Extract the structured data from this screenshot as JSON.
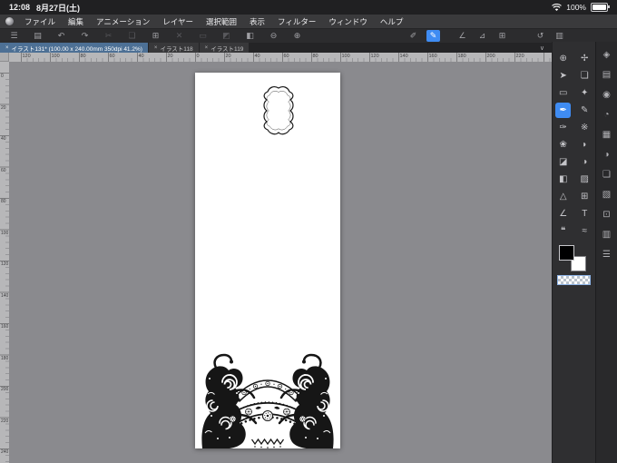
{
  "status_bar": {
    "time": "12:08",
    "date": "8月27日(土)",
    "battery_percent": "100%"
  },
  "menu_bar": {
    "items": [
      {
        "name": "menu-file",
        "label": "ファイル"
      },
      {
        "name": "menu-edit",
        "label": "編集"
      },
      {
        "name": "menu-animation",
        "label": "アニメーション"
      },
      {
        "name": "menu-layer",
        "label": "レイヤー"
      },
      {
        "name": "menu-selection",
        "label": "選択範囲"
      },
      {
        "name": "menu-view",
        "label": "表示"
      },
      {
        "name": "menu-filter",
        "label": "フィルター"
      },
      {
        "name": "menu-window",
        "label": "ウィンドウ"
      },
      {
        "name": "menu-help",
        "label": "ヘルプ"
      }
    ]
  },
  "command_bar": {
    "left_icons": [
      {
        "name": "app-menu-icon",
        "glyph": "☰"
      },
      {
        "name": "save-icon",
        "glyph": "▤"
      },
      {
        "name": "undo-icon",
        "glyph": "↶"
      },
      {
        "name": "redo-icon",
        "glyph": "↷"
      },
      {
        "name": "cut-icon",
        "glyph": "✂",
        "disabled": true
      },
      {
        "name": "copy-icon",
        "glyph": "❏",
        "disabled": true
      },
      {
        "name": "paste-icon",
        "glyph": "⊞"
      },
      {
        "name": "delete-icon",
        "glyph": "✕",
        "disabled": true
      },
      {
        "name": "deselect-icon",
        "glyph": "▭",
        "disabled": true
      },
      {
        "name": "invert-selection-icon",
        "glyph": "◩",
        "disabled": true
      },
      {
        "name": "fill-icon",
        "glyph": "◧"
      },
      {
        "name": "zoom-out-icon",
        "glyph": "⊖"
      },
      {
        "name": "zoom-in-icon",
        "glyph": "⊕"
      }
    ],
    "mode_icons": [
      {
        "name": "line-edit-icon",
        "glyph": "✐"
      },
      {
        "name": "draw-line-icon",
        "glyph": "✎",
        "active": true
      }
    ],
    "snap_icons": [
      {
        "name": "snap-ruler-icon",
        "glyph": "∠"
      },
      {
        "name": "snap-special-ruler-icon",
        "glyph": "⊿"
      },
      {
        "name": "snap-grid-icon",
        "glyph": "⊞"
      }
    ],
    "view_icons": [
      {
        "name": "rotate-reset-icon",
        "glyph": "↺"
      },
      {
        "name": "panel-layout-icon",
        "glyph": "▥"
      }
    ]
  },
  "tab_bar": {
    "tabs": [
      {
        "name": "tab-illust-131",
        "label": "イラスト131* (100.00 x 240.00mm 350dpi 41.2%)",
        "close": "×",
        "active": true
      },
      {
        "name": "tab-illust-118",
        "label": "イラスト118",
        "close": "×",
        "active": false
      },
      {
        "name": "tab-illust-119",
        "label": "イラスト119",
        "close": "×",
        "active": false
      }
    ],
    "overflow_icon": "∨"
  },
  "rulers": {
    "horizontal": [
      120,
      100,
      80,
      60,
      40,
      20,
      0,
      20,
      40,
      60,
      80,
      100,
      120,
      140,
      160,
      180,
      200,
      220
    ],
    "vertical": [
      0,
      20,
      40,
      60,
      80,
      100,
      120,
      140,
      160,
      180,
      200,
      220,
      240
    ]
  },
  "tool_panel": {
    "tools": [
      {
        "name": "zoom-tool-icon",
        "glyph": "⊕"
      },
      {
        "name": "pan-tool-icon",
        "glyph": "✢"
      },
      {
        "name": "operation-tool-icon",
        "glyph": "➤"
      },
      {
        "name": "layer-move-tool-icon",
        "glyph": "❏"
      },
      {
        "name": "selection-tool-icon",
        "glyph": "▭"
      },
      {
        "name": "auto-select-tool-icon",
        "glyph": "✦"
      },
      {
        "name": "pen-tool-icon",
        "glyph": "✒",
        "active": true
      },
      {
        "name": "pencil-tool-icon",
        "glyph": "✎"
      },
      {
        "name": "brush-tool-icon",
        "glyph": "✑"
      },
      {
        "name": "airbrush-tool-icon",
        "glyph": "※"
      },
      {
        "name": "decoration-tool-icon",
        "glyph": "❀"
      },
      {
        "name": "eyedropper-tool-icon",
        "glyph": "◗"
      },
      {
        "name": "eraser-tool-icon",
        "glyph": "◪"
      },
      {
        "name": "blend-tool-icon",
        "glyph": "◑"
      },
      {
        "name": "fill-tool-icon",
        "glyph": "◧"
      },
      {
        "name": "gradient-tool-icon",
        "glyph": "▨"
      },
      {
        "name": "figure-tool-icon",
        "glyph": "△"
      },
      {
        "name": "frame-border-tool-icon",
        "glyph": "⊞"
      },
      {
        "name": "ruler-tool-icon",
        "glyph": "∠"
      },
      {
        "name": "text-tool-icon",
        "glyph": "T"
      },
      {
        "name": "balloon-tool-icon",
        "glyph": "❝"
      },
      {
        "name": "line-correction-tool-icon",
        "glyph": "≈"
      }
    ]
  },
  "color_swatches": {
    "foreground": "#000000",
    "background": "#ffffff",
    "transparent": "transparent-color"
  },
  "side_strip": {
    "icons": [
      {
        "name": "quick-access-panel-icon",
        "glyph": "◈"
      },
      {
        "name": "tool-property-panel-icon",
        "glyph": "▤"
      },
      {
        "name": "brush-size-panel-icon",
        "glyph": "◉"
      },
      {
        "name": "color-wheel-panel-icon",
        "glyph": "◔"
      },
      {
        "name": "color-set-panel-icon",
        "glyph": "▦"
      },
      {
        "name": "color-mix-panel-icon",
        "glyph": "◑"
      },
      {
        "name": "layer-panel-icon",
        "glyph": "❏"
      },
      {
        "name": "layer-property-panel-icon",
        "glyph": "▧"
      },
      {
        "name": "navigator-panel-icon",
        "glyph": "⊡"
      },
      {
        "name": "material-panel-icon",
        "glyph": "▥"
      },
      {
        "name": "sub-view-panel-icon",
        "glyph": "☰"
      }
    ]
  },
  "colors": {
    "accent": "#3f8cf3",
    "active_tab": "#4d7095",
    "canvas_background": "#8a8a8e",
    "chrome_dark": "#2c2c2e"
  }
}
